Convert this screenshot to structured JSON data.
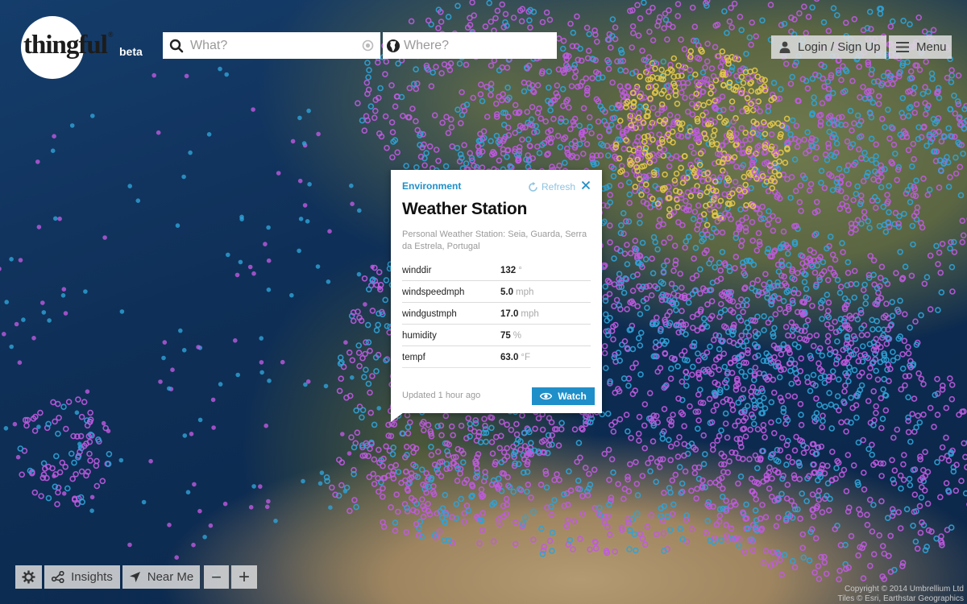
{
  "brand": {
    "name": "thingful",
    "registered": "®",
    "tag": "beta"
  },
  "search": {
    "what_placeholder": "What?",
    "where_placeholder": "Where?"
  },
  "header": {
    "login_label": "Login / Sign Up",
    "menu_label": "Menu"
  },
  "popup": {
    "category": "Environment",
    "refresh_label": "Refresh",
    "title": "Weather Station",
    "description": "Personal Weather Station: Seia, Guarda, Serra da Estrela, Portugal",
    "rows": [
      {
        "key": "winddir",
        "value": "132",
        "unit": "°"
      },
      {
        "key": "windspeedmph",
        "value": "5.0",
        "unit": "mph"
      },
      {
        "key": "windgustmph",
        "value": "17.0",
        "unit": "mph"
      },
      {
        "key": "humidity",
        "value": "75",
        "unit": "%"
      },
      {
        "key": "tempf",
        "value": "63.0",
        "unit": "°F"
      }
    ],
    "updated": "Updated 1 hour ago",
    "watch_label": "Watch"
  },
  "toolbar": {
    "insights_label": "Insights",
    "near_me_label": "Near Me",
    "zoom_out": "−",
    "zoom_in": "+"
  },
  "attribution": {
    "line1": "Copyright © 2014 Umbrellium Ltd",
    "line2": "Tiles © Esri, Earthstar Geographics"
  },
  "colors": {
    "accent": "#1f8fc9",
    "marker_purple": "#c05ae0",
    "marker_blue": "#2fa3d8",
    "marker_yellow": "#e4c84a"
  },
  "icons": {
    "search": "search-icon",
    "globe": "globe-icon",
    "locate": "locate-icon",
    "user": "user-icon",
    "menu": "hamburger-icon",
    "refresh": "refresh-icon",
    "close": "close-icon",
    "eye": "eye-icon",
    "settings": "gear-icon",
    "insights": "share-nodes-icon",
    "near_me": "navigation-arrow-icon"
  }
}
